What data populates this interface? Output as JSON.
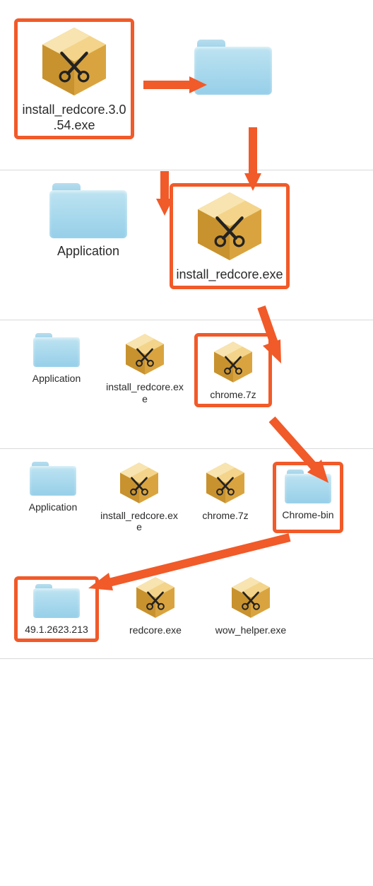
{
  "panel1": {
    "items": [
      {
        "name": "install_redcore.3.0.54.exe",
        "type": "box",
        "highlight": true
      },
      {
        "name": "",
        "type": "folder"
      }
    ]
  },
  "panel2": {
    "items": [
      {
        "name": "Application",
        "type": "folder"
      },
      {
        "name": "install_redcore.exe",
        "type": "box",
        "highlight": true
      }
    ]
  },
  "panel3": {
    "items": [
      {
        "name": "Application",
        "type": "folder"
      },
      {
        "name": "install_redcore.exe",
        "type": "box"
      },
      {
        "name": "chrome.7z",
        "type": "box",
        "highlight": true
      }
    ]
  },
  "panel4": {
    "row1": [
      {
        "name": "Application",
        "type": "folder"
      },
      {
        "name": "install_redcore.exe",
        "type": "box"
      },
      {
        "name": "chrome.7z",
        "type": "box"
      },
      {
        "name": "Chrome-bin",
        "type": "folder",
        "highlight": true
      }
    ],
    "row2": [
      {
        "name": "49.1.2623.213",
        "type": "folder",
        "highlight": true
      },
      {
        "name": "redcore.exe",
        "type": "box"
      },
      {
        "name": "wow_helper.exe",
        "type": "box"
      }
    ]
  }
}
